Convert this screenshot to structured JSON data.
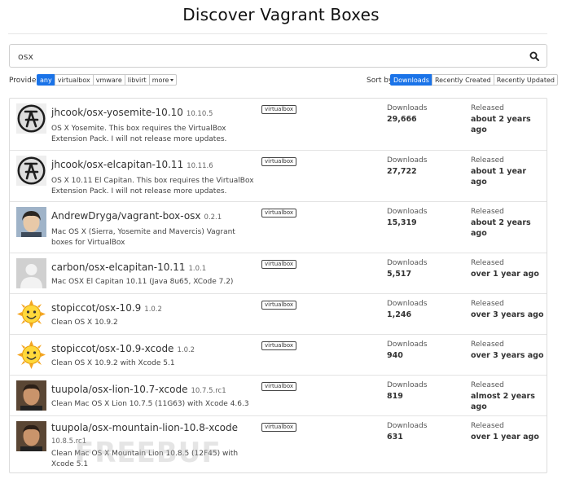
{
  "page": {
    "title": "Discover Vagrant Boxes"
  },
  "search": {
    "value": "osx",
    "placeholder": ""
  },
  "provider": {
    "label": "Provider",
    "options": [
      "any",
      "virtualbox",
      "vmware",
      "libvirt"
    ],
    "more_label": "more",
    "selected": "any"
  },
  "sort": {
    "label": "Sort by",
    "options": [
      "Downloads",
      "Recently Created",
      "Recently Updated"
    ],
    "selected": "Downloads"
  },
  "labels": {
    "downloads": "Downloads",
    "released": "Released"
  },
  "boxes": [
    {
      "name": "jhcook/osx-yosemite-10.10",
      "version": "10.10.5",
      "description": "OS X Yosemite. This box requires the VirtualBox Extension Pack. I will not release more updates.",
      "provider": "virtualbox",
      "downloads": "29,666",
      "released": "about 2 years ago",
      "avatar": "lambda-logo"
    },
    {
      "name": "jhcook/osx-elcapitan-10.11",
      "version": "10.11.6",
      "description": "OS X 10.11 El Capitan. This box requires the VirtualBox Extension Pack. I will not release more updates.",
      "provider": "virtualbox",
      "downloads": "27,722",
      "released": "about 1 year ago",
      "avatar": "lambda-logo"
    },
    {
      "name": "AndrewDryga/vagrant-box-osx",
      "version": "0.2.1",
      "description": "Mac OS X (Sierra, Yosemite and Mavercis) Vagrant boxes for VirtualBox",
      "provider": "virtualbox",
      "downloads": "15,319",
      "released": "about 2 years ago",
      "avatar": "user-photo"
    },
    {
      "name": "carbon/osx-elcapitan-10.11",
      "version": "1.0.1",
      "description": "Mac OSX El Capitan 10.11 (Java 8u65, XCode 7.2)",
      "provider": "virtualbox",
      "downloads": "5,517",
      "released": "over 1 year ago",
      "avatar": "default-avatar"
    },
    {
      "name": "stopiccot/osx-10.9",
      "version": "1.0.2",
      "description": "Clean OS X 10.9.2",
      "provider": "virtualbox",
      "downloads": "1,246",
      "released": "over 3 years ago",
      "avatar": "sun-emoji"
    },
    {
      "name": "stopiccot/osx-10.9-xcode",
      "version": "1.0.2",
      "description": "Clean OS X 10.9.2 with Xcode 5.1",
      "provider": "virtualbox",
      "downloads": "940",
      "released": "over 3 years ago",
      "avatar": "sun-emoji"
    },
    {
      "name": "tuupola/osx-lion-10.7-xcode",
      "version": "10.7.5.rc1",
      "description": "Clean Mac OS X Lion 10.7.5 (11G63) with Xcode 4.6.3",
      "provider": "virtualbox",
      "downloads": "819",
      "released": "almost 2 years ago",
      "avatar": "user-photo-2"
    },
    {
      "name": "tuupola/osx-mountain-lion-10.8-xcode",
      "version": "10.8.5.rc1",
      "description": "Clean Mac OS X Mountain Lion 10.8.5 (12F45) with Xcode 5.1",
      "provider": "virtualbox",
      "downloads": "631",
      "released": "over 1 year ago",
      "avatar": "user-photo-2"
    }
  ],
  "watermark": "FREEBUF",
  "colors": {
    "accent": "#1a73e8"
  }
}
